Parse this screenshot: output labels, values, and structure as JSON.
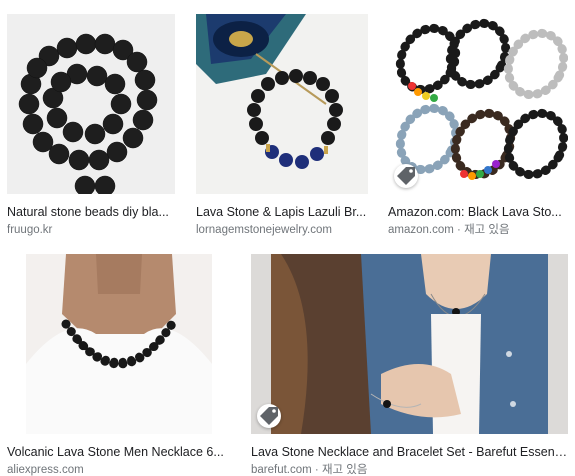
{
  "results": [
    {
      "title": "Natural stone beads diy bla...",
      "source": "fruugo.kr",
      "stock": ""
    },
    {
      "title": "Lava Stone & Lapis Lazuli Br...",
      "source": "lornagemstonejewelry.com",
      "stock": ""
    },
    {
      "title": "Amazon.com: Black Lava Sto...",
      "source": "amazon.com",
      "stock": " · 재고 있음"
    },
    {
      "title": "Volcanic Lava Stone Men Necklace 6...",
      "source": "aliexpress.com",
      "stock": ""
    },
    {
      "title": "Lava Stone Necklace and Bracelet Set - Barefut Essenti...",
      "source": "barefut.com",
      "stock": " · 재고 있음"
    }
  ],
  "icons": {
    "product_tag": "tag-icon"
  },
  "colors": {
    "title": "#202124",
    "source": "#70757a",
    "lava_bead": "#1c1c1c",
    "lapis_bead": "#1f2f7a"
  }
}
